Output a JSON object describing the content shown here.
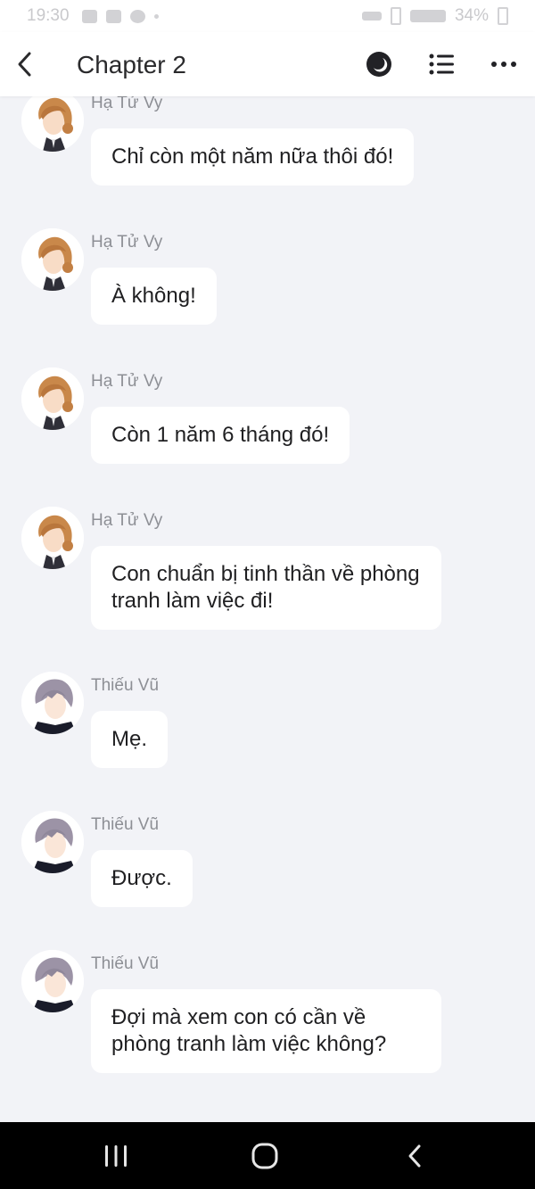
{
  "status_bar": {
    "time": "19:30",
    "battery": "34%"
  },
  "header": {
    "title": "Chapter 2",
    "icons": [
      "back-arrow-icon",
      "theme-toggle-icon",
      "list-icon",
      "more-icon"
    ]
  },
  "messages": [
    {
      "sender": "Hạ Tử Vy",
      "text": "Chỉ còn một năm nữa thôi đó!",
      "avatar": "female"
    },
    {
      "sender": "Hạ Tử Vy",
      "text": "À không!",
      "avatar": "female"
    },
    {
      "sender": "Hạ Tử Vy",
      "text": "Còn 1 năm 6 tháng đó!",
      "avatar": "female"
    },
    {
      "sender": "Hạ Tử Vy",
      "text": "Con chuẩn bị tinh thần về phòng tranh làm việc đi!",
      "avatar": "female"
    },
    {
      "sender": "Thiếu Vũ",
      "text": "Mẹ.",
      "avatar": "male"
    },
    {
      "sender": "Thiếu Vũ",
      "text": "Được.",
      "avatar": "male"
    },
    {
      "sender": "Thiếu Vũ",
      "text": "Đợi mà xem con có cần về phòng tranh làm việc không?",
      "avatar": "male"
    }
  ],
  "colors": {
    "background": "#f2f3f7",
    "bubble": "#ffffff",
    "sender_text": "#8d8f95",
    "nav_bar": "#000000"
  }
}
